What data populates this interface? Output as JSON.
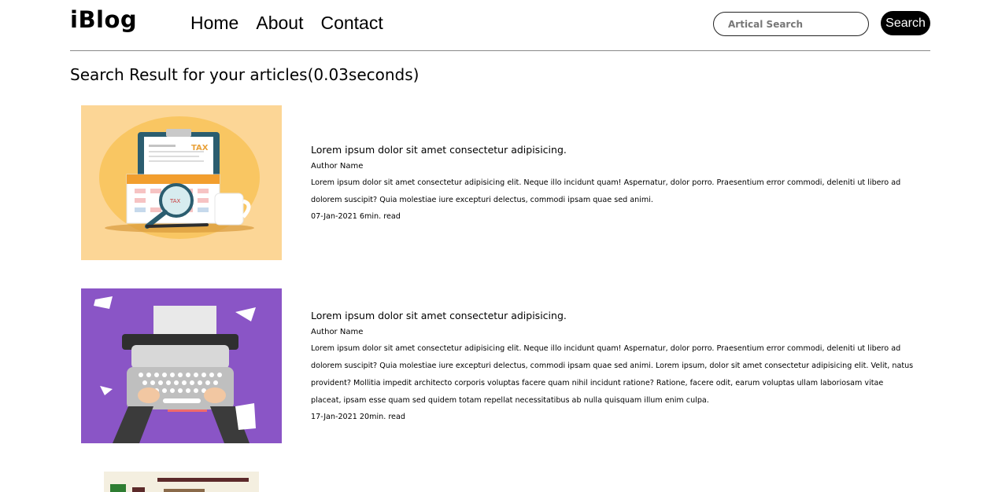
{
  "brand": "iBlog",
  "nav": [
    "Home",
    "About",
    "Contact"
  ],
  "search": {
    "placeholder": "Artical Search",
    "button": "Search"
  },
  "results_title": "Search Result for your articles(0.03seconds)",
  "articles": [
    {
      "title": "Lorem ipsum dolor sit amet consectetur adipisicing.",
      "author": "Author Name",
      "excerpt": "Lorem ipsum dolor sit amet consectetur adipisicing elit. Neque illo incidunt quam! Aspernatur, dolor porro. Praesentium error commodi, deleniti ut libero ad dolorem suscipit? Quia molestiae iure excepturi delectus, commodi ipsam quae sed animi.",
      "meta": "07-Jan-2021 6min. read"
    },
    {
      "title": "Lorem ipsum dolor sit amet consectetur adipisicing.",
      "author": "Author Name",
      "excerpt": "Lorem ipsum dolor sit amet consectetur adipisicing elit. Neque illo incidunt quam! Aspernatur, dolor porro. Praesentium error commodi, deleniti ut libero ad dolorem suscipit? Quia molestiae iure excepturi delectus, commodi ipsam quae sed animi. Lorem ipsum, dolor sit amet consectetur adipisicing elit. Velit, natus provident? Mollitia impedit architecto corporis voluptas facere quam nihil incidunt ratione? Ratione, facere odit, earum voluptas ullam laboriosam vitae placeat, ipsam esse quam sed quidem totam repellat necessitatibus ab nulla quisquam illum enim culpa.",
      "meta": "17-Jan-2021 20min. read"
    }
  ],
  "colors": {
    "accent": "#000000",
    "thumb1_bg": "#fcd696",
    "thumb2_bg": "#8a55c6",
    "thumb3_bg": "#f4efe0"
  }
}
